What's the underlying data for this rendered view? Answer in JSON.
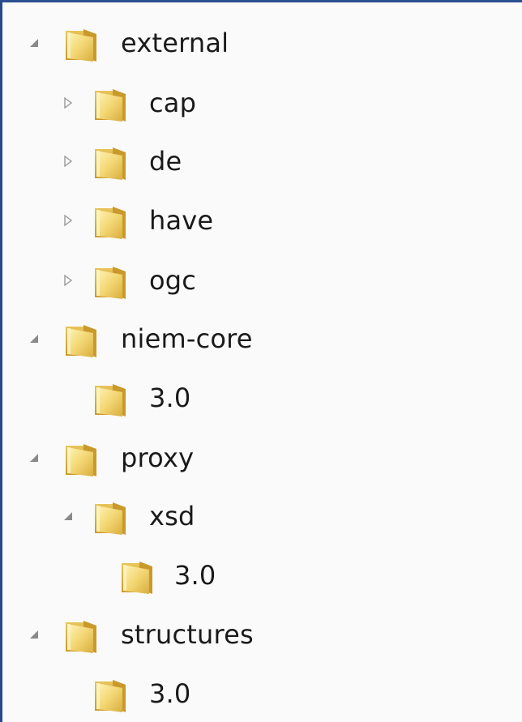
{
  "tree": {
    "items": [
      {
        "label": "external",
        "state": "expanded",
        "icon": "folder-icon"
      },
      {
        "label": "cap",
        "state": "collapsed",
        "icon": "folder-icon"
      },
      {
        "label": "de",
        "state": "collapsed",
        "icon": "folder-icon"
      },
      {
        "label": "have",
        "state": "collapsed",
        "icon": "folder-icon"
      },
      {
        "label": "ogc",
        "state": "collapsed",
        "icon": "folder-icon"
      },
      {
        "label": "niem-core",
        "state": "expanded",
        "icon": "folder-icon"
      },
      {
        "label": "3.0",
        "state": "leaf",
        "icon": "folder-icon"
      },
      {
        "label": "proxy",
        "state": "expanded",
        "icon": "folder-icon"
      },
      {
        "label": "xsd",
        "state": "expanded",
        "icon": "folder-icon"
      },
      {
        "label": "3.0",
        "state": "leaf",
        "icon": "folder-icon"
      },
      {
        "label": "structures",
        "state": "expanded",
        "icon": "folder-icon"
      },
      {
        "label": "3.0",
        "state": "leaf",
        "icon": "folder-icon"
      }
    ]
  },
  "colors": {
    "frame_border": "#274a8c",
    "background": "#fbfafa",
    "folder_body": "#f2d46a",
    "folder_shade": "#d9b23c",
    "expander": "#8a8a8a"
  }
}
